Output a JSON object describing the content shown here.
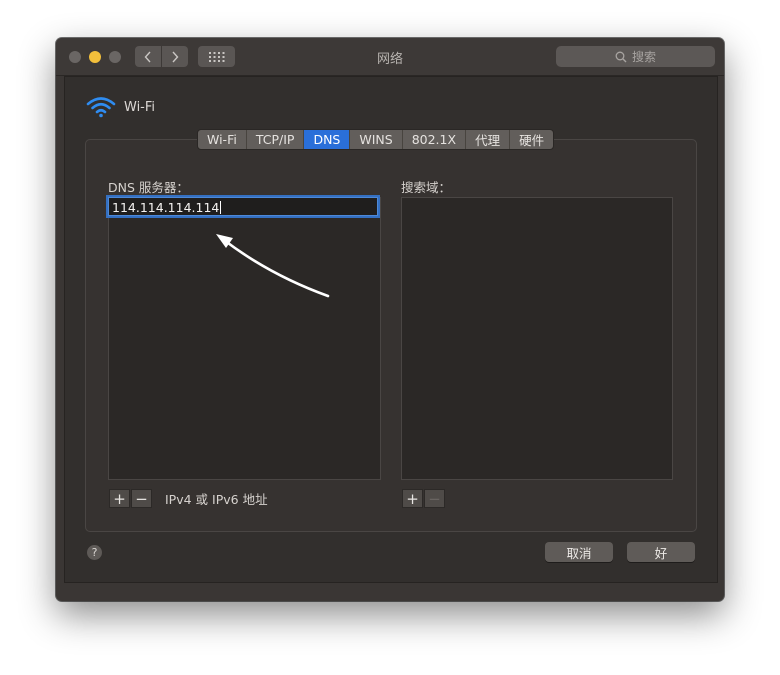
{
  "window": {
    "title": "网络"
  },
  "titlebar": {
    "back_icon": "chevron-left-icon",
    "forward_icon": "chevron-right-icon",
    "grid_icon": "grid-icon",
    "search_placeholder": "搜索"
  },
  "header": {
    "network_name": "Wi-Fi",
    "icon": "wifi-icon",
    "icon_color": "#2f8cf0"
  },
  "tabs": [
    {
      "label": "Wi-Fi",
      "active": false
    },
    {
      "label": "TCP/IP",
      "active": false
    },
    {
      "label": "DNS",
      "active": true
    },
    {
      "label": "WINS",
      "active": false
    },
    {
      "label": "802.1X",
      "active": false
    },
    {
      "label": "代理",
      "active": false
    },
    {
      "label": "硬件",
      "active": false
    }
  ],
  "dns": {
    "label": "DNS 服务器：",
    "servers": [
      "114.114.114.114"
    ],
    "add_label": "+",
    "remove_label": "−",
    "hint": "IPv4 或 IPv6 地址"
  },
  "search_domains": {
    "label": "搜索域：",
    "add_label": "+",
    "remove_label": "−"
  },
  "footer": {
    "help_label": "?",
    "cancel_label": "取消",
    "ok_label": "好"
  },
  "colors": {
    "accent": "#2a6fd9",
    "window_bg": "#3a3634",
    "annotation_arrow": "#ffffff"
  }
}
